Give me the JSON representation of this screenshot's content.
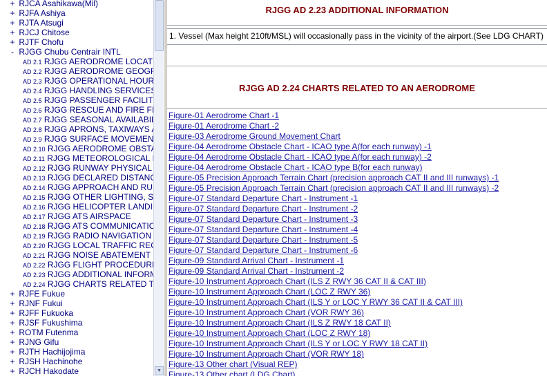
{
  "tree": {
    "top": [
      {
        "label": "RJCA Asahikawa(Mil)",
        "state": "+"
      },
      {
        "label": "RJFA Ashiya",
        "state": "+"
      },
      {
        "label": "RJTA Atsugi",
        "state": "+"
      },
      {
        "label": "RJCJ Chitose",
        "state": "+"
      },
      {
        "label": "RJTF Chofu",
        "state": "+"
      },
      {
        "label": "RJGG Chubu Centrair INTL",
        "state": "-"
      }
    ],
    "children": [
      {
        "num": "AD 2.1",
        "text": "RJGG AERODROME LOCATION INDICATOR AND NAME"
      },
      {
        "num": "AD 2.2",
        "text": "RJGG AERODROME GEOGRAPHICAL AND ADMINISTRATIVE DATA"
      },
      {
        "num": "AD 2.3",
        "text": "RJGG OPERATIONAL HOURS"
      },
      {
        "num": "AD 2.4",
        "text": "RJGG HANDLING SERVICES AND FACILITIES"
      },
      {
        "num": "AD 2.5",
        "text": "RJGG PASSENGER FACILITIES"
      },
      {
        "num": "AD 2.6",
        "text": "RJGG RESCUE AND FIRE FIGHTING SERVICES"
      },
      {
        "num": "AD 2.7",
        "text": "RJGG SEASONAL AVAILABILITY - CLEARING"
      },
      {
        "num": "AD 2.8",
        "text": "RJGG APRONS, TAXIWAYS AND CHECK LOCATIONS DATA"
      },
      {
        "num": "AD 2.9",
        "text": "RJGG SURFACE MOVEMENT GUIDANCE AND CONTROL SYSTEM"
      },
      {
        "num": "AD 2.10",
        "text": "RJGG AERODROME OBSTACLES"
      },
      {
        "num": "AD 2.11",
        "text": "RJGG METEOROLOGICAL INFORMATION PROVIDED"
      },
      {
        "num": "AD 2.12",
        "text": "RJGG RUNWAY PHYSICAL CHARACTERISTICS"
      },
      {
        "num": "AD 2.13",
        "text": "RJGG DECLARED DISTANCES"
      },
      {
        "num": "AD 2.14",
        "text": "RJGG APPROACH AND RUNWAY LIGHTING"
      },
      {
        "num": "AD 2.15",
        "text": "RJGG OTHER LIGHTING, SECONDARY POWER SUPPLY"
      },
      {
        "num": "AD 2.16",
        "text": "RJGG HELICOPTER LANDING AREA"
      },
      {
        "num": "AD 2.17",
        "text": "RJGG ATS AIRSPACE"
      },
      {
        "num": "AD 2.18",
        "text": "RJGG ATS COMMUNICATION FACILITIES"
      },
      {
        "num": "AD 2.19",
        "text": "RJGG RADIO NAVIGATION AND LANDING AIDS"
      },
      {
        "num": "AD 2.20",
        "text": "RJGG LOCAL TRAFFIC REGULATIONS"
      },
      {
        "num": "AD 2.21",
        "text": "RJGG NOISE ABATEMENT PROCEDURES"
      },
      {
        "num": "AD 2.22",
        "text": "RJGG FLIGHT PROCEDURES"
      },
      {
        "num": "AD 2.23",
        "text": "RJGG ADDITIONAL INFORMATION"
      },
      {
        "num": "AD 2.24",
        "text": "RJGG CHARTS RELATED TO AN AERODROME"
      }
    ],
    "bottom": [
      {
        "label": "RJFE Fukue",
        "state": "+"
      },
      {
        "label": "RJNF Fukui",
        "state": "+"
      },
      {
        "label": "RJFF Fukuoka",
        "state": "+"
      },
      {
        "label": "RJSF Fukushima",
        "state": "+"
      },
      {
        "label": "ROTM Futenma",
        "state": "+"
      },
      {
        "label": "RJNG Gifu",
        "state": "+"
      },
      {
        "label": "RJTH Hachijojima",
        "state": "+"
      },
      {
        "label": "RJSH Hachinohe",
        "state": "+"
      },
      {
        "label": "RJCH Hakodate",
        "state": "+"
      }
    ]
  },
  "content": {
    "section1_title": "RJGG AD 2.23  ADDITIONAL INFORMATION",
    "section1_note": "1. Vessel (Max height 210ft/MSL) will occasionally pass in the vicinity of the airport.(See LDG CHART)",
    "section2_title": "RJGG AD 2.24  CHARTS RELATED TO AN AERODROME",
    "charts": [
      "Figure-01 Aerodrome Chart -1",
      "Figure-01 Aerodrome Chart -2",
      "Figure-03 Aerodrome Ground Movement Chart",
      "Figure-04 Aerodrome Obstacle Chart - ICAO type A(for each runway) -1",
      "Figure-04 Aerodrome Obstacle Chart - ICAO type A(for each runway) -2",
      "Figure-04 Aerodrome Obstacle Chart - ICAO type B(for each runway)",
      "Figure-05 Precision Approach Terrain Chart (precision approach CAT II and III runways) -1",
      "Figure-05 Precision Approach Terrain Chart (precision approach CAT II and III runways) -2",
      "Figure-07 Standard Departure Chart - Instrument -1",
      "Figure-07 Standard Departure Chart - Instrument -2",
      "Figure-07 Standard Departure Chart - Instrument -3",
      "Figure-07 Standard Departure Chart - Instrument -4",
      "Figure-07 Standard Departure Chart - Instrument -5",
      "Figure-07 Standard Departure Chart - Instrument -6",
      "Figure-09 Standard Arrival Chart - Instrument -1",
      "Figure-09 Standard Arrival Chart - Instrument -2",
      "Figure-10 Instrument Approach Chart (ILS Z RWY 36 CAT II & CAT III)",
      "Figure-10 Instrument Approach Chart (LOC Z RWY 36)",
      "Figure-10 Instrument Approach Chart (ILS Y or LOC Y RWY 36 CAT II & CAT III)",
      "Figure-10 Instrument Approach Chart (VOR RWY 36)",
      "Figure-10 Instrument Approach Chart (ILS Z RWY 18 CAT II)",
      "Figure-10 Instrument Approach Chart (LOC Z RWY 18)",
      "Figure-10 Instrument Approach Chart (ILS Y or LOC Y RWY 18 CAT II)",
      "Figure-10 Instrument Approach Chart (VOR RWY 18)",
      "Figure-13 Other chart (Visual REP)",
      "Figure-13 Other chart (LDG Chart)"
    ]
  }
}
